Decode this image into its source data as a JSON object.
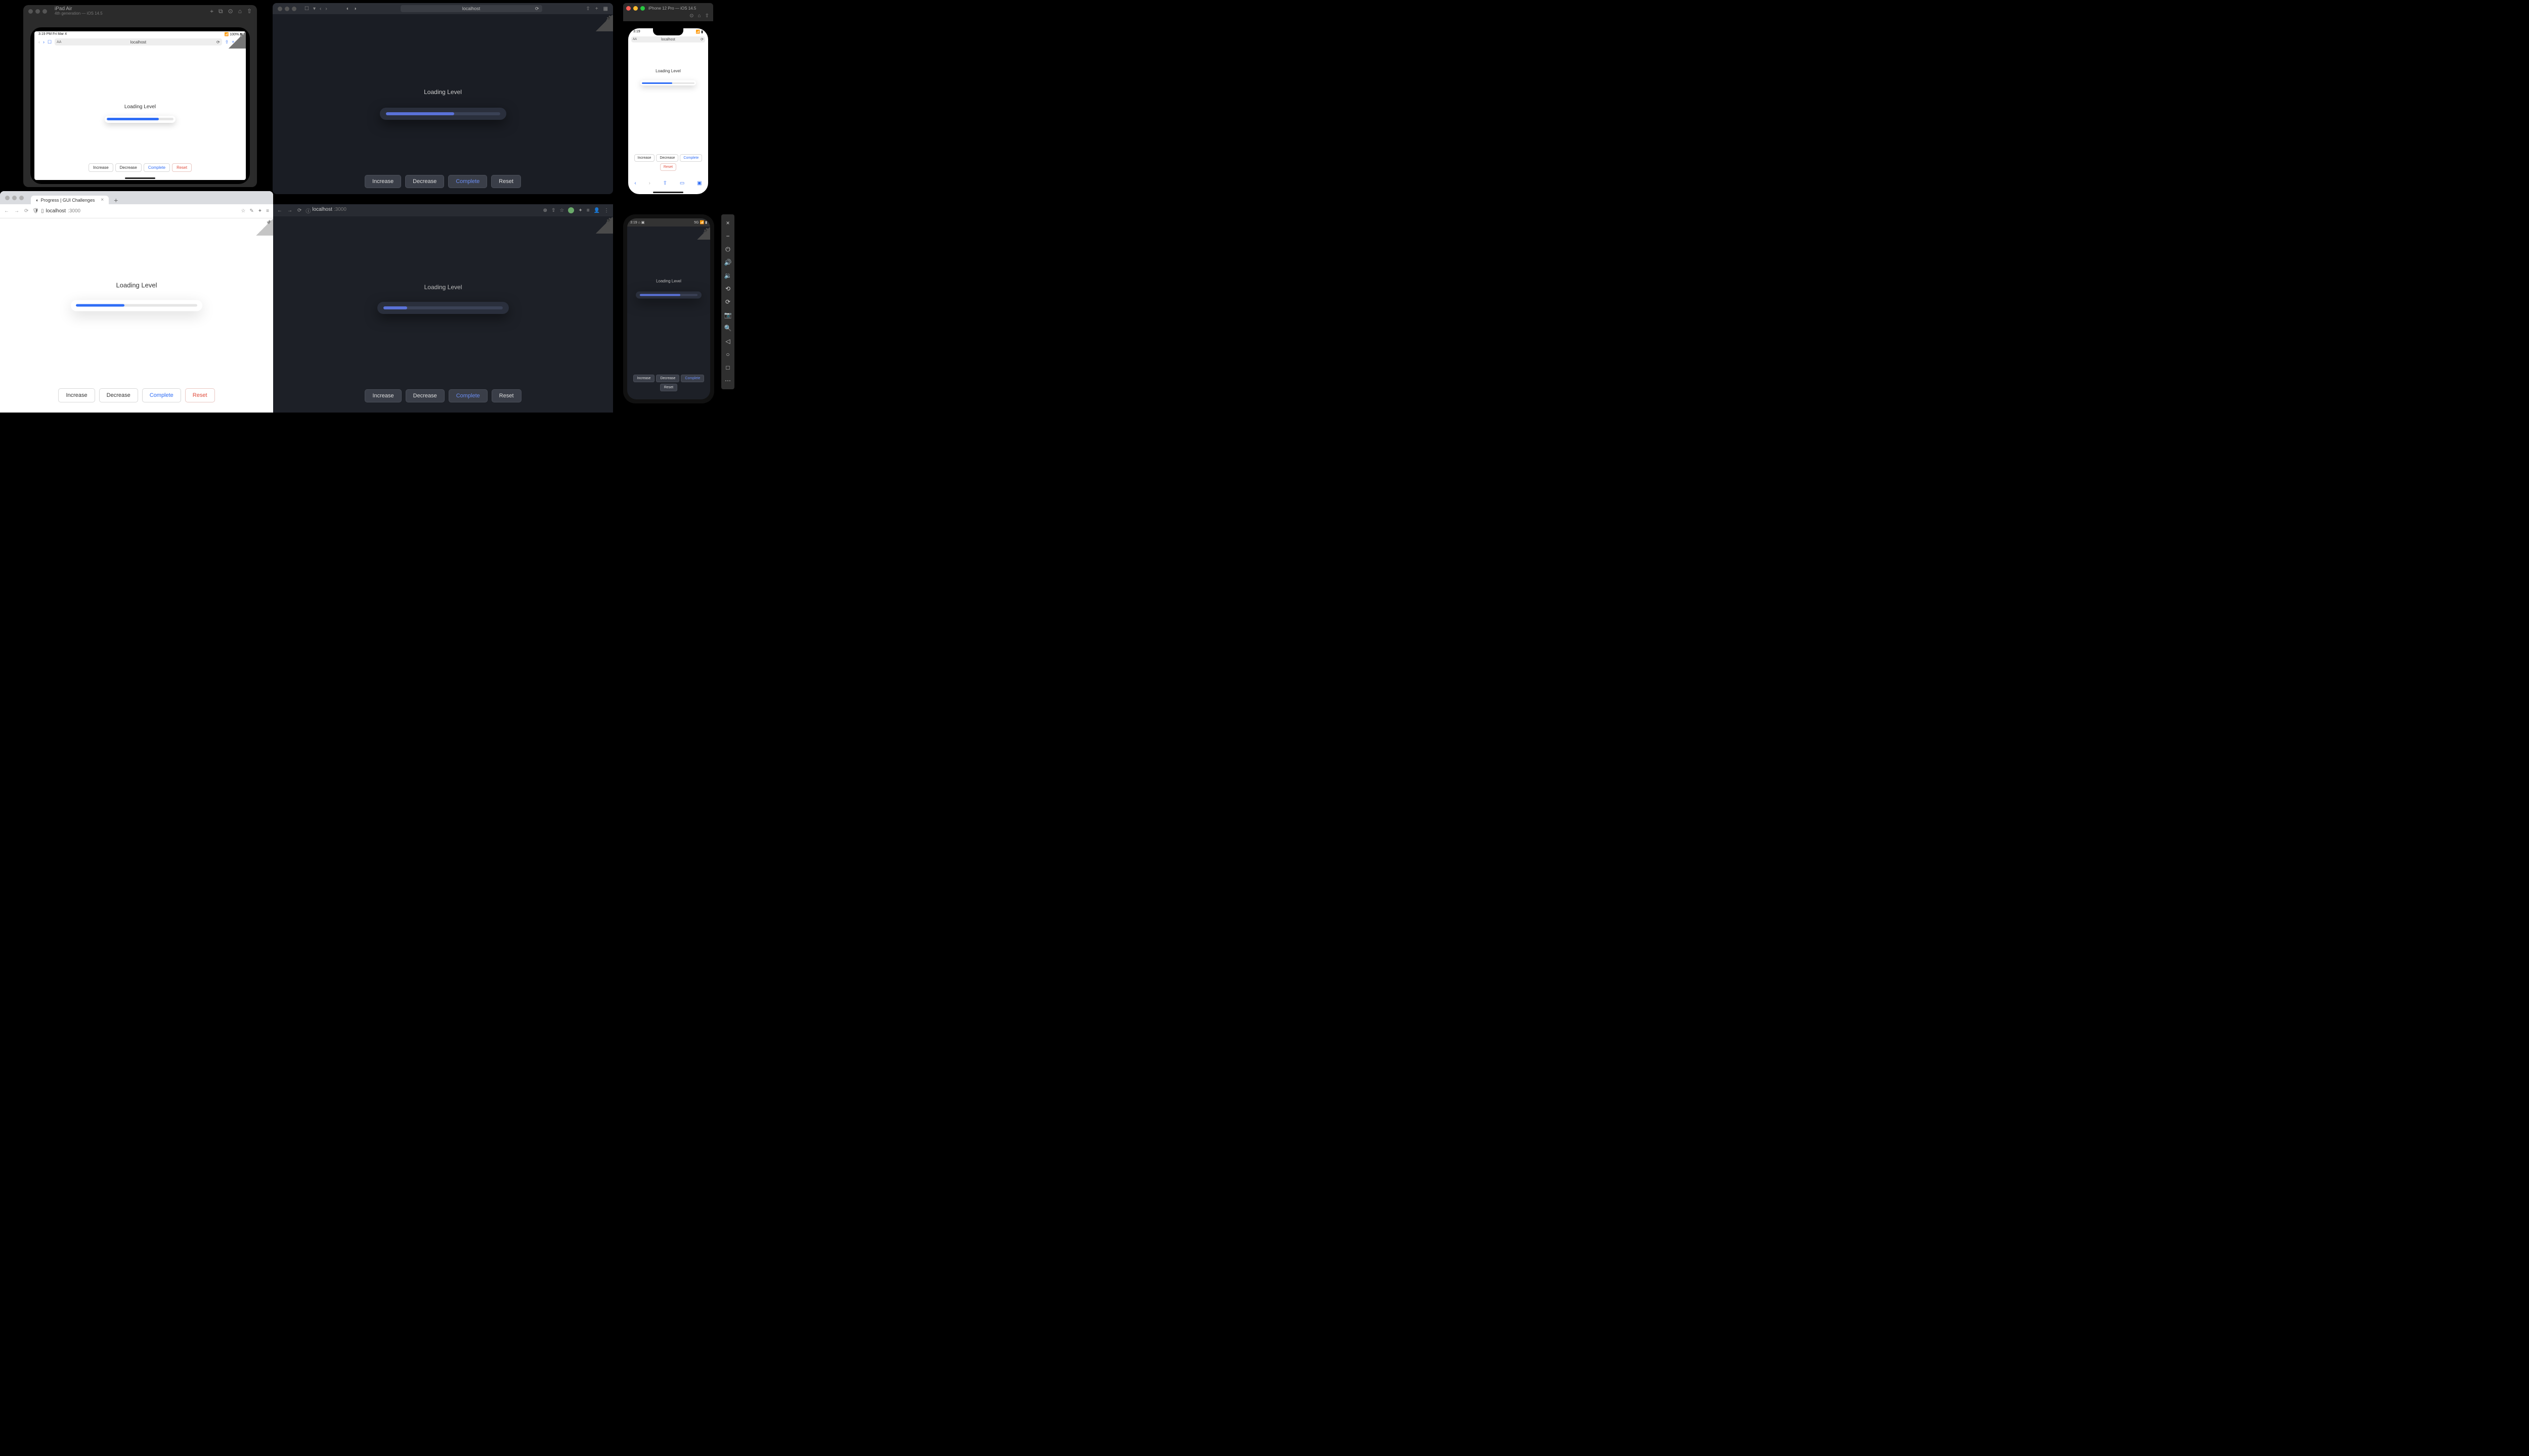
{
  "app": {
    "loading_label": "Loading Level",
    "buttons": {
      "increase": "Increase",
      "decrease": "Decrease",
      "complete": "Complete",
      "reset": "Reset"
    }
  },
  "ipad": {
    "title": "iPad Air",
    "subtitle": "4th generation — iOS 14.5",
    "status_left": "3:19 PM  Fri Mar 4",
    "status_right": "100%",
    "url": "localhost",
    "progress_pct": 78
  },
  "safari": {
    "url": "localhost",
    "progress_pct": 60
  },
  "iphone": {
    "title": "iPhone 12 Pro — iOS 14.5",
    "time": "3:19",
    "url": "localhost",
    "progress_pct": 58
  },
  "chrome_light": {
    "tab_title": "Progress | GUI Challenges",
    "host": "localhost",
    "port": ":3000",
    "progress_pct": 40
  },
  "chrome_dark": {
    "host": "localhost",
    "port": ":3000",
    "progress_pct": 20
  },
  "android": {
    "time": "3:19",
    "progress_pct": 70
  },
  "colors": {
    "accent_light": "#2f6df6",
    "accent_dark": "#5a72d8",
    "reset": "#e04b3b"
  }
}
